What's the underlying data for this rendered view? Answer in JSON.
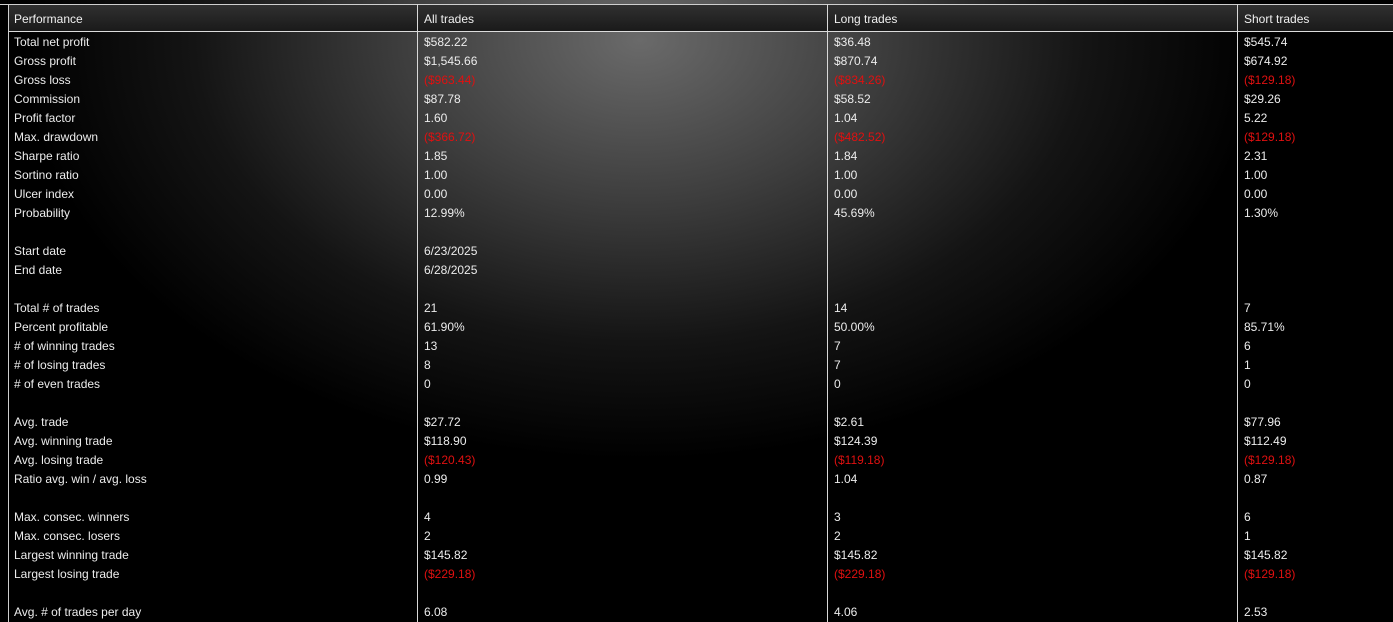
{
  "header": {
    "performance": "Performance",
    "all_trades": "All trades",
    "long_trades": "Long trades",
    "short_trades": "Short trades"
  },
  "colors": {
    "negative": "#e01010",
    "text": "#ececec",
    "grid_line": "#d8d8d8"
  },
  "rows": [
    {
      "label": "Total net profit",
      "all": "$582.22",
      "long": "$36.48",
      "short": "$545.74",
      "neg": [
        false,
        false,
        false
      ]
    },
    {
      "label": "Gross profit",
      "all": "$1,545.66",
      "long": "$870.74",
      "short": "$674.92",
      "neg": [
        false,
        false,
        false
      ]
    },
    {
      "label": "Gross loss",
      "all": "($963.44)",
      "long": "($834.26)",
      "short": "($129.18)",
      "neg": [
        true,
        true,
        true
      ]
    },
    {
      "label": "Commission",
      "all": "$87.78",
      "long": "$58.52",
      "short": "$29.26",
      "neg": [
        false,
        false,
        false
      ]
    },
    {
      "label": "Profit factor",
      "all": "1.60",
      "long": "1.04",
      "short": "5.22",
      "neg": [
        false,
        false,
        false
      ]
    },
    {
      "label": "Max. drawdown",
      "all": "($366.72)",
      "long": "($482.52)",
      "short": "($129.18)",
      "neg": [
        true,
        true,
        true
      ]
    },
    {
      "label": "Sharpe ratio",
      "all": "1.85",
      "long": "1.84",
      "short": "2.31",
      "neg": [
        false,
        false,
        false
      ]
    },
    {
      "label": "Sortino ratio",
      "all": "1.00",
      "long": "1.00",
      "short": "1.00",
      "neg": [
        false,
        false,
        false
      ]
    },
    {
      "label": "Ulcer index",
      "all": "0.00",
      "long": "0.00",
      "short": "0.00",
      "neg": [
        false,
        false,
        false
      ]
    },
    {
      "label": "Probability",
      "all": "12.99%",
      "long": "45.69%",
      "short": "1.30%",
      "neg": [
        false,
        false,
        false
      ]
    },
    {
      "label": "",
      "all": "",
      "long": "",
      "short": "",
      "neg": [
        false,
        false,
        false
      ]
    },
    {
      "label": "Start date",
      "all": "6/23/2025",
      "long": "",
      "short": "",
      "neg": [
        false,
        false,
        false
      ]
    },
    {
      "label": "End date",
      "all": "6/28/2025",
      "long": "",
      "short": "",
      "neg": [
        false,
        false,
        false
      ]
    },
    {
      "label": "",
      "all": "",
      "long": "",
      "short": "",
      "neg": [
        false,
        false,
        false
      ]
    },
    {
      "label": "Total # of trades",
      "all": "21",
      "long": "14",
      "short": "7",
      "neg": [
        false,
        false,
        false
      ]
    },
    {
      "label": "Percent profitable",
      "all": "61.90%",
      "long": "50.00%",
      "short": "85.71%",
      "neg": [
        false,
        false,
        false
      ]
    },
    {
      "label": "# of winning trades",
      "all": "13",
      "long": "7",
      "short": "6",
      "neg": [
        false,
        false,
        false
      ]
    },
    {
      "label": "# of losing trades",
      "all": "8",
      "long": "7",
      "short": "1",
      "neg": [
        false,
        false,
        false
      ]
    },
    {
      "label": "# of even trades",
      "all": "0",
      "long": "0",
      "short": "0",
      "neg": [
        false,
        false,
        false
      ]
    },
    {
      "label": "",
      "all": "",
      "long": "",
      "short": "",
      "neg": [
        false,
        false,
        false
      ]
    },
    {
      "label": "Avg. trade",
      "all": "$27.72",
      "long": "$2.61",
      "short": "$77.96",
      "neg": [
        false,
        false,
        false
      ]
    },
    {
      "label": "Avg. winning trade",
      "all": "$118.90",
      "long": "$124.39",
      "short": "$112.49",
      "neg": [
        false,
        false,
        false
      ]
    },
    {
      "label": "Avg. losing trade",
      "all": "($120.43)",
      "long": "($119.18)",
      "short": "($129.18)",
      "neg": [
        true,
        true,
        true
      ]
    },
    {
      "label": "Ratio avg. win / avg. loss",
      "all": "0.99",
      "long": "1.04",
      "short": "0.87",
      "neg": [
        false,
        false,
        false
      ]
    },
    {
      "label": "",
      "all": "",
      "long": "",
      "short": "",
      "neg": [
        false,
        false,
        false
      ]
    },
    {
      "label": "Max. consec. winners",
      "all": "4",
      "long": "3",
      "short": "6",
      "neg": [
        false,
        false,
        false
      ]
    },
    {
      "label": "Max. consec. losers",
      "all": "2",
      "long": "2",
      "short": "1",
      "neg": [
        false,
        false,
        false
      ]
    },
    {
      "label": "Largest winning trade",
      "all": "$145.82",
      "long": "$145.82",
      "short": "$145.82",
      "neg": [
        false,
        false,
        false
      ]
    },
    {
      "label": "Largest losing trade",
      "all": "($229.18)",
      "long": "($229.18)",
      "short": "($129.18)",
      "neg": [
        true,
        true,
        true
      ]
    },
    {
      "label": "",
      "all": "",
      "long": "",
      "short": "",
      "neg": [
        false,
        false,
        false
      ]
    },
    {
      "label": "Avg. # of trades per day",
      "all": "6.08",
      "long": "4.06",
      "short": "2.53",
      "neg": [
        false,
        false,
        false
      ]
    }
  ]
}
